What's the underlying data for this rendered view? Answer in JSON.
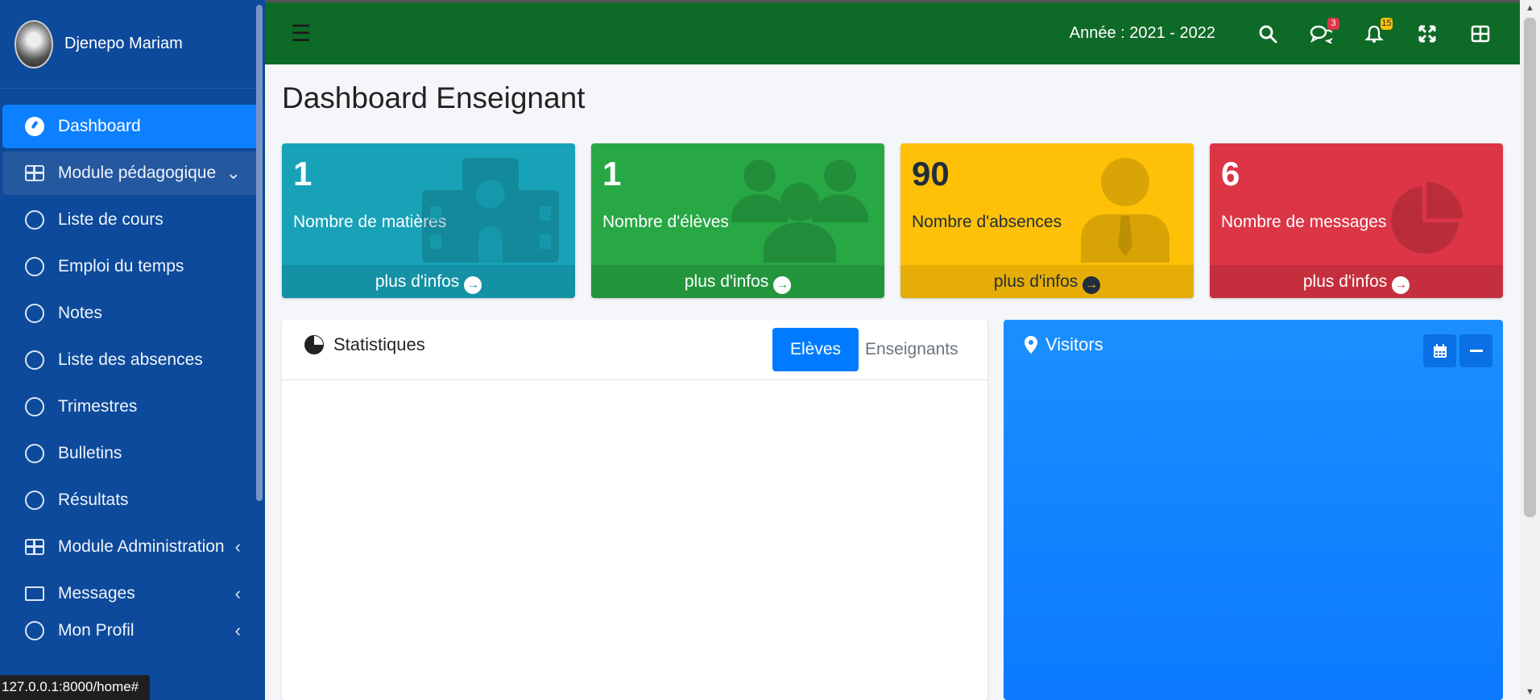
{
  "sidebar": {
    "user_name": "Djenepo Mariam",
    "items": [
      {
        "label": "Dashboard",
        "icon": "dashboard-gauge-icon"
      },
      {
        "label": "Module pédagogique",
        "icon": "table-icon"
      },
      {
        "label": "Liste de cours",
        "icon": "circle-icon"
      },
      {
        "label": "Emploi du temps",
        "icon": "circle-icon"
      },
      {
        "label": "Notes",
        "icon": "circle-icon"
      },
      {
        "label": "Liste des absences",
        "icon": "circle-icon"
      },
      {
        "label": "Trimestres",
        "icon": "circle-icon"
      },
      {
        "label": "Bulletins",
        "icon": "circle-icon"
      },
      {
        "label": "Résultats",
        "icon": "circle-icon"
      },
      {
        "label": "Module Administration",
        "icon": "table-icon"
      },
      {
        "label": "Messages",
        "icon": "envelope-icon"
      },
      {
        "label": "Mon Profil",
        "icon": "user-icon"
      }
    ]
  },
  "topbar": {
    "year_label": "Année : 2021 - 2022",
    "messages_badge": "3",
    "notifications_badge": "15"
  },
  "page": {
    "title": "Dashboard Enseignant"
  },
  "stat_boxes": [
    {
      "value": "1",
      "label": "Nombre de matières",
      "footer": "plus d'infos",
      "color": "#17a2b8",
      "icon": "school-icon"
    },
    {
      "value": "1",
      "label": "Nombre d'élèves",
      "footer": "plus d'infos",
      "color": "#28a745",
      "icon": "users-icon"
    },
    {
      "value": "90",
      "label": "Nombre d'absences",
      "footer": "plus d'infos",
      "color": "#ffc107",
      "icon": "user-tie-icon"
    },
    {
      "value": "6",
      "label": "Nombre de messages",
      "footer": "plus d'infos",
      "color": "#dc3545",
      "icon": "pie-chart-icon"
    }
  ],
  "stats_card": {
    "title": "Statistiques",
    "tabs": [
      "Elèves",
      "Enseignants"
    ]
  },
  "visitors_card": {
    "title": "Visitors"
  },
  "status_bar": {
    "url": "127.0.0.1:8000/home#"
  }
}
